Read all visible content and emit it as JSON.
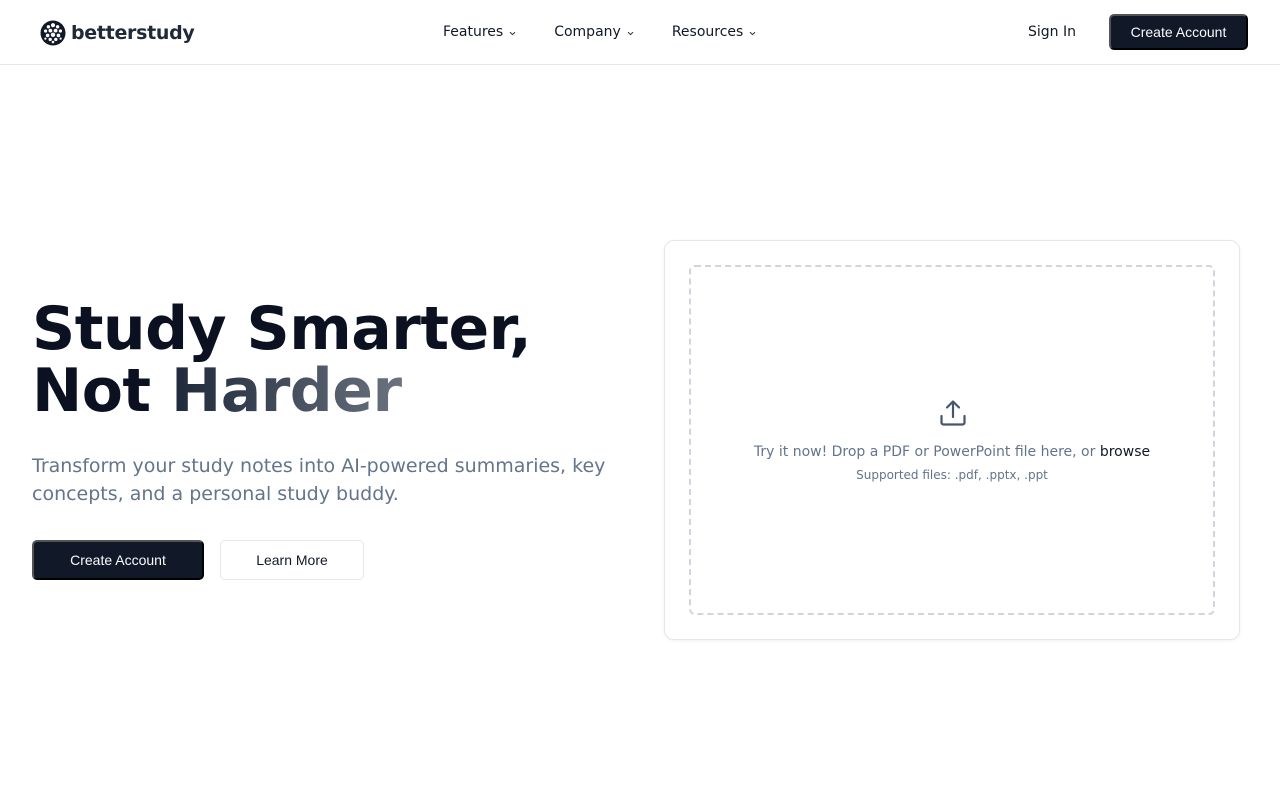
{
  "brand": {
    "name": "betterstudy"
  },
  "nav": {
    "items": [
      {
        "label": "Features"
      },
      {
        "label": "Company"
      },
      {
        "label": "Resources"
      }
    ],
    "sign_in": "Sign In",
    "create_account": "Create Account"
  },
  "hero": {
    "title_line1": "Study Smarter,",
    "title_line2_plain": "Not ",
    "title_line2_accent": "Harder",
    "subtitle": "Transform your study notes into AI-powered summaries, key concepts, and a personal study buddy.",
    "primary_button": "Create Account",
    "secondary_button": "Learn More"
  },
  "upload": {
    "prompt": "Try it now! Drop a PDF or PowerPoint file here, or",
    "browse": "browse",
    "supported": "Supported files: .pdf, .pptx, .ppt"
  },
  "icons": {
    "logo": "cluster-dots-icon",
    "dropdown": "chevron-down-icon",
    "upload": "upload-icon"
  },
  "colors": {
    "primary": "#111827",
    "muted_text": "#64748b",
    "border": "#e5e7eb"
  }
}
